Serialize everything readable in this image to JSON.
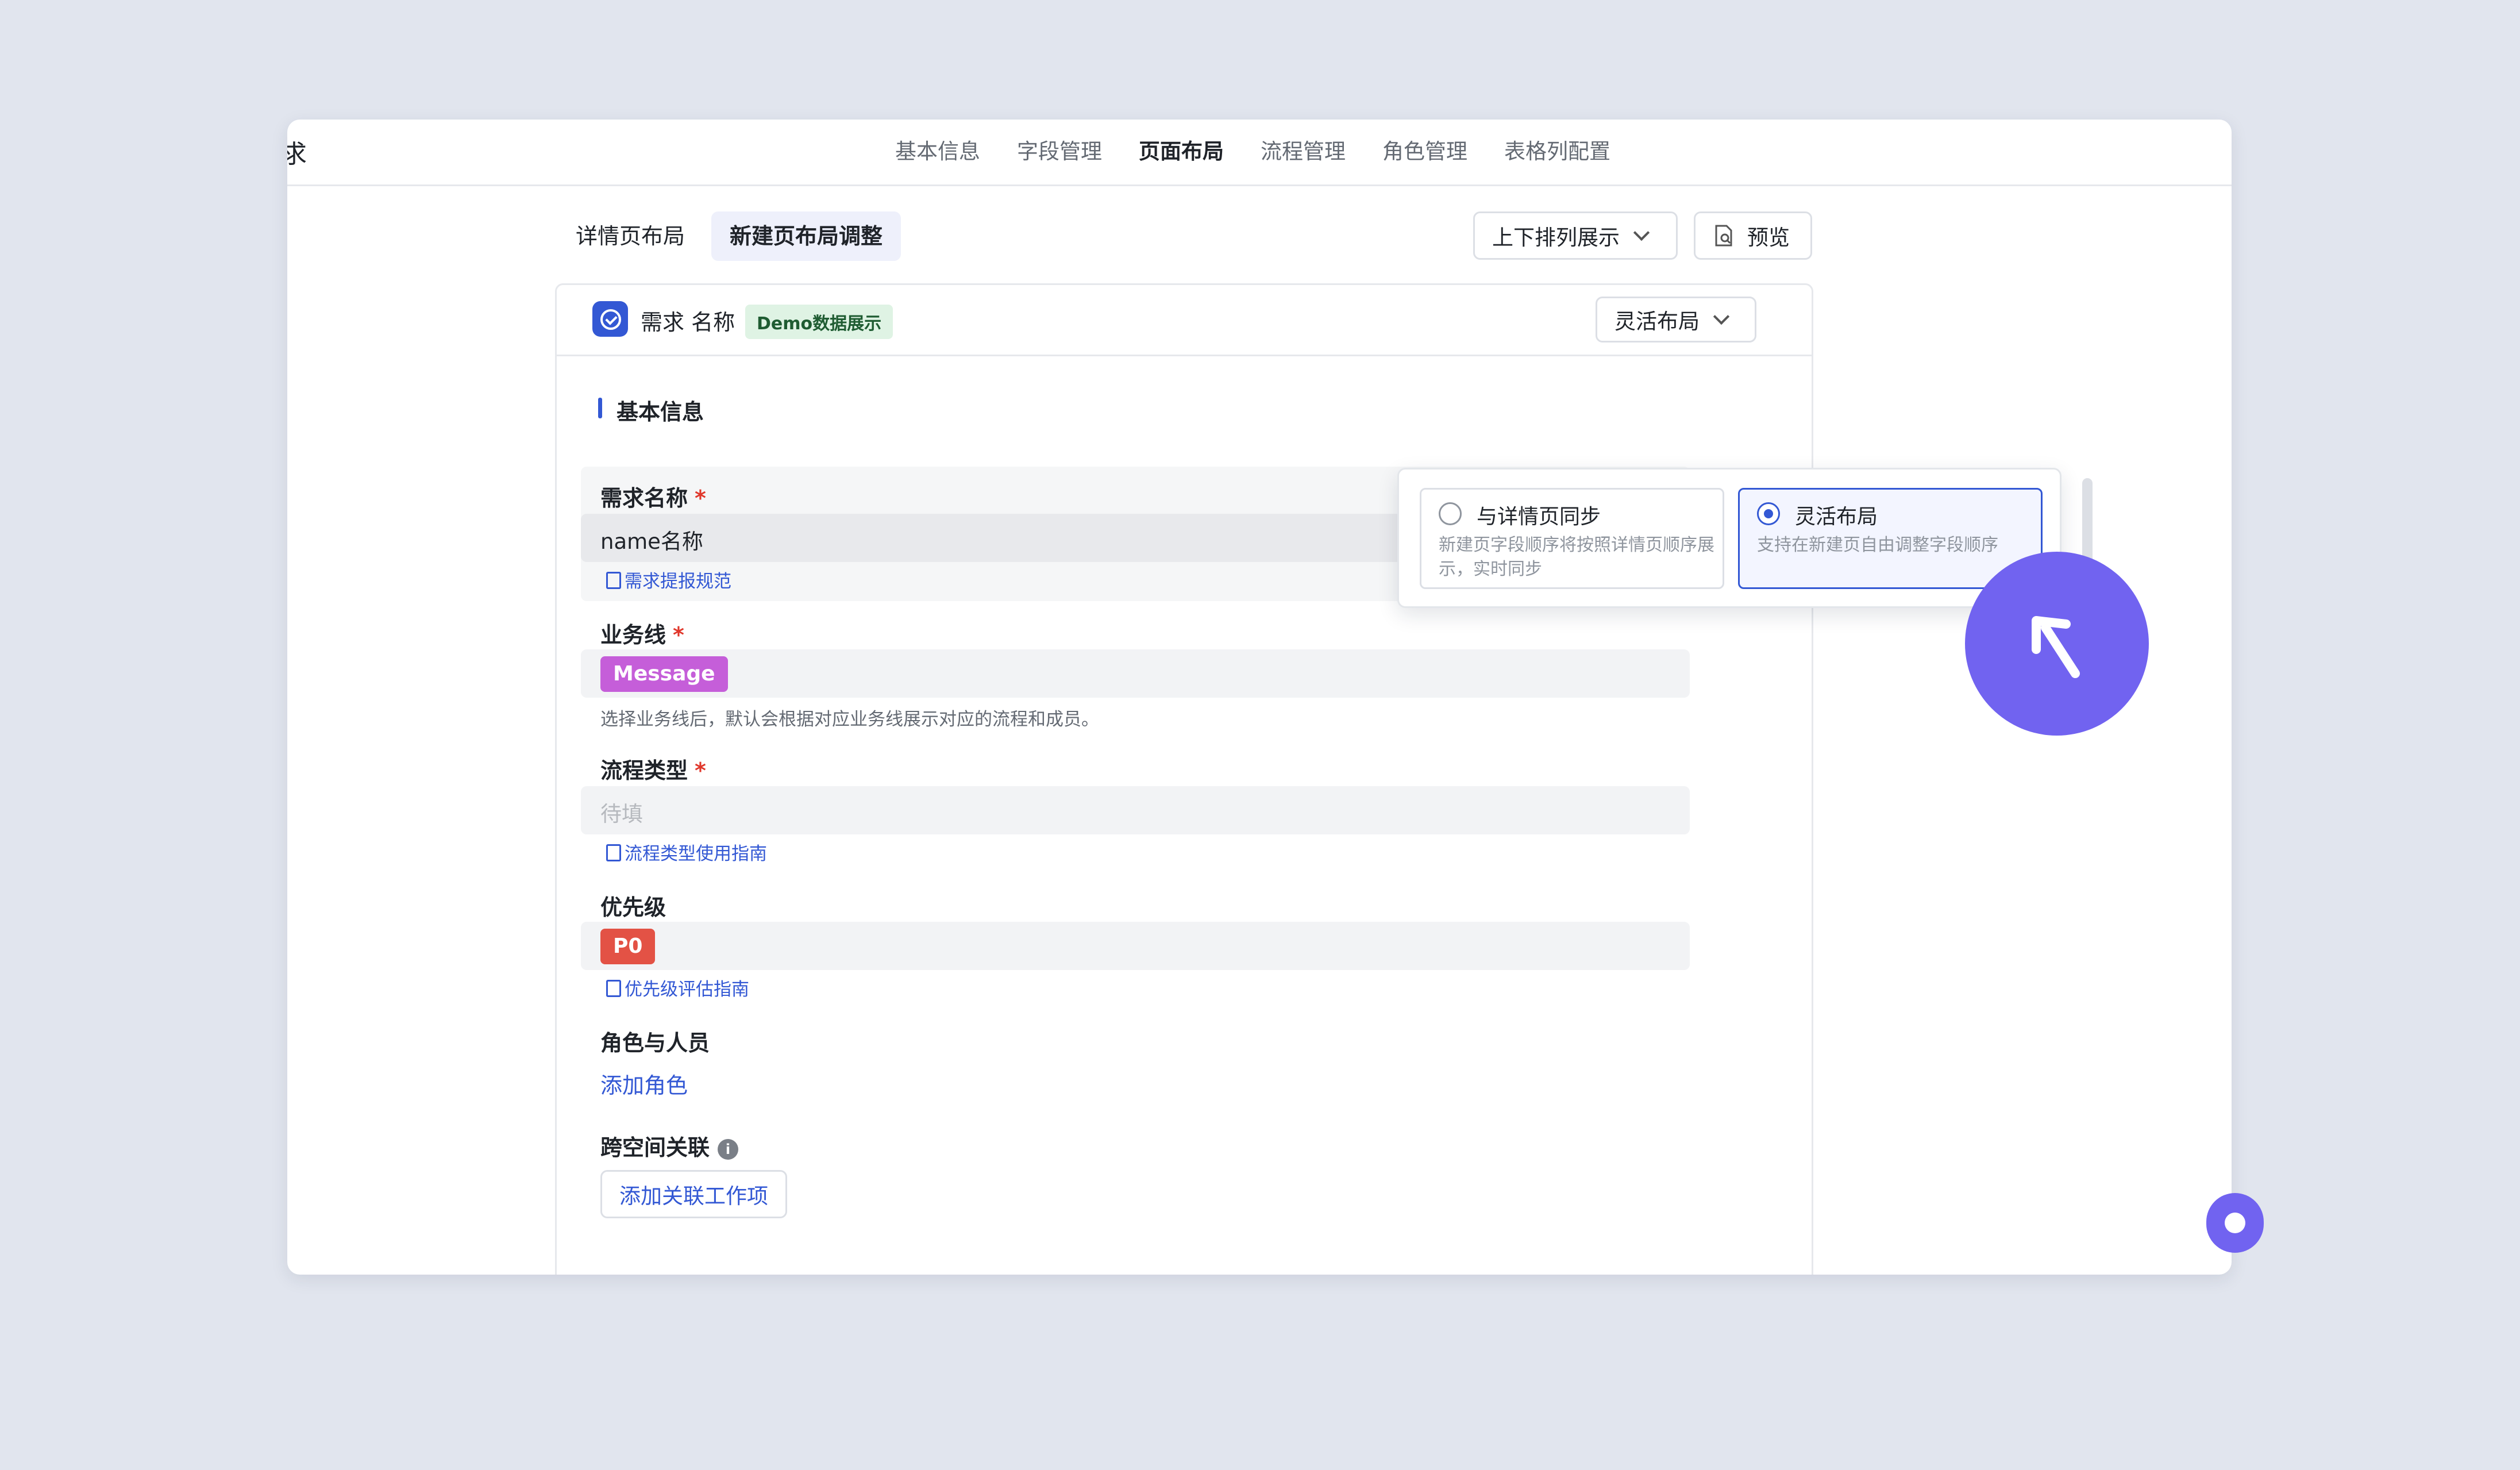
{
  "window": {
    "edge_char": "求",
    "top_tabs": [
      "基本信息",
      "字段管理",
      "页面布局",
      "流程管理",
      "角色管理",
      "表格列配置"
    ],
    "active_tab": "页面布局"
  },
  "subtabs": {
    "detail": "详情页布局",
    "new": "新建页布局调整"
  },
  "toolbar": {
    "sort_label": "上下排列展示",
    "preview_label": "预览"
  },
  "card": {
    "title": "需求 名称",
    "badge": "Demo数据展示",
    "layout_select": "灵活布局"
  },
  "section": {
    "title": "基本信息"
  },
  "fields": {
    "name": {
      "label": "需求名称",
      "required": "*",
      "value": "name名称",
      "link": "需求提报规范"
    },
    "business_line": {
      "label": "业务线",
      "required": "*",
      "tag": "Message",
      "help": "选择业务线后，默认会根据对应业务线展示对应的流程和成员。"
    },
    "process_type": {
      "label": "流程类型",
      "required": "*",
      "placeholder": "待填",
      "link": "流程类型使用指南"
    },
    "priority": {
      "label": "优先级",
      "tag": "P0",
      "link": "优先级评估指南"
    },
    "roles": {
      "label": "角色与人员",
      "add": "添加角色"
    },
    "cross_space": {
      "label": "跨空间关联",
      "info": "i",
      "add": "添加关联工作项"
    }
  },
  "popover": {
    "option1": {
      "title": "与详情页同步",
      "desc": "新建页字段顺序将按照详情页顺序展示，实时同步"
    },
    "option2": {
      "title": "灵活布局",
      "desc": "支持在新建页自由调整字段顺序"
    }
  },
  "colors": {
    "accent": "#3358d4",
    "cursor": "#7163f0",
    "tag_message": "#c55ed9",
    "tag_p0": "#e35245",
    "required": "#e0372b"
  },
  "icons": {
    "preview": "preview-doc-icon",
    "chevron": "chevron-down-icon",
    "check": "check-circle-icon",
    "cursor": "arrow-up-left-icon"
  }
}
